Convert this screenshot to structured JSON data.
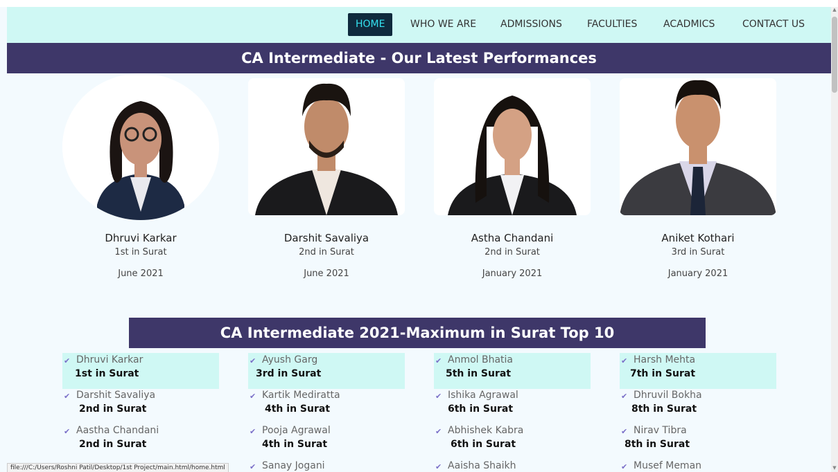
{
  "nav": {
    "items": [
      "HOME",
      "WHO WE ARE",
      "ADMISSIONS",
      "FACULTIES",
      "ACADMICS",
      "CONTACT US"
    ]
  },
  "banner": {
    "title": "CA Intermediate - Our Latest Performances"
  },
  "toppers": [
    {
      "name": "Dhruvi Karkar",
      "rank": "1st in Surat",
      "date": "June 2021"
    },
    {
      "name": "Darshit Savaliya",
      "rank": "2nd in Surat",
      "date": "June 2021"
    },
    {
      "name": "Astha Chandani",
      "rank": "2nd in Surat",
      "date": "January 2021"
    },
    {
      "name": "Aniket Kothari",
      "rank": "3rd in Surat",
      "date": "January 2021"
    }
  ],
  "top10": {
    "title": "CA Intermediate 2021-Maximum in Surat Top 10",
    "columns": [
      [
        {
          "name": "Dhruvi Karkar",
          "rank": "1st in Surat"
        },
        {
          "name": "Darshit Savaliya",
          "rank": "2nd in Surat"
        },
        {
          "name": "Aastha Chandani",
          "rank": "2nd in Surat"
        }
      ],
      [
        {
          "name": "Ayush Garg",
          "rank": "3rd in Surat"
        },
        {
          "name": "Kartik Mediratta",
          "rank": "4th in Surat"
        },
        {
          "name": "Pooja Agrawal",
          "rank": "4th in Surat"
        },
        {
          "name": "Sanay Jogani",
          "rank": ""
        }
      ],
      [
        {
          "name": "Anmol Bhatia",
          "rank": "5th in Surat"
        },
        {
          "name": "Ishika Agrawal",
          "rank": "6th in Surat"
        },
        {
          "name": "Abhishek Kabra",
          "rank": "6th in Surat"
        },
        {
          "name": "Aaisha Shaikh",
          "rank": ""
        }
      ],
      [
        {
          "name": "Harsh Mehta",
          "rank": "7th in Surat"
        },
        {
          "name": "Dhruvil Bokha",
          "rank": "8th in Surat"
        },
        {
          "name": "Nirav Tibra",
          "rank": "8th in Surat"
        },
        {
          "name": "Musef Meman",
          "rank": ""
        }
      ]
    ]
  },
  "status": {
    "url": "file:///C:/Users/Roshni Patil/Desktop/1st Project/main.html/home.html"
  },
  "icons": {
    "check": "check-icon"
  }
}
